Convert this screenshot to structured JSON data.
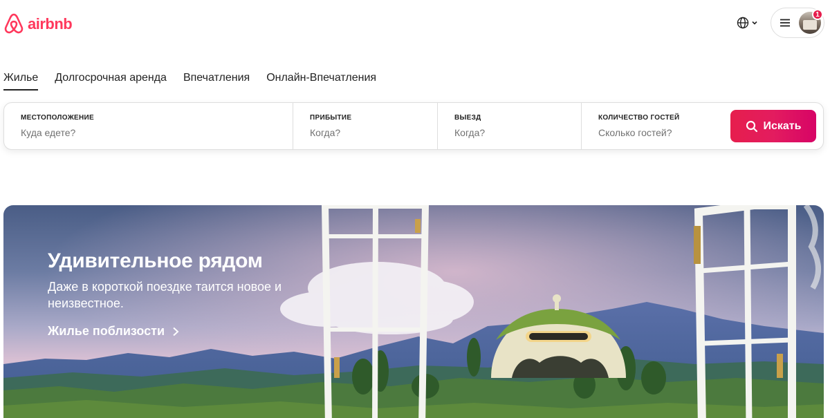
{
  "header": {
    "logo_text": "airbnb",
    "brand_color": "#FF385C",
    "language_icon": "globe-icon",
    "menu_icon": "hamburger-menu-icon",
    "notification_count": "1"
  },
  "tabs": [
    {
      "label": "Жилье",
      "active": true
    },
    {
      "label": "Долгосрочная аренда",
      "active": false
    },
    {
      "label": "Впечатления",
      "active": false
    },
    {
      "label": "Онлайн-Впечатления",
      "active": false
    }
  ],
  "search": {
    "location": {
      "label": "МЕСТОПОЛОЖЕНИЕ",
      "placeholder": "Куда едете?"
    },
    "checkin": {
      "label": "ПРИБЫТИЕ",
      "placeholder": "Когда?"
    },
    "checkout": {
      "label": "ВЫЕЗД",
      "placeholder": "Когда?"
    },
    "guests": {
      "label": "КОЛИЧЕСТВО ГОСТЕЙ",
      "placeholder": "Сколько гостей?"
    },
    "button_label": "Искать",
    "button_color": "#E61E4D"
  },
  "hero": {
    "title": "Удивительное рядом",
    "subtitle": "Даже в короткой поездке таится новое и неизвестное.",
    "link_label": "Жилье поблизости"
  }
}
